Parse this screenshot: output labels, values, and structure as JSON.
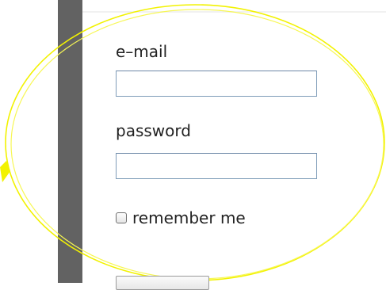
{
  "login_form": {
    "email_label": "e–mail",
    "email_value": "",
    "password_label": "password",
    "password_value": "",
    "remember_label": "remember me",
    "remember_checked": false
  },
  "colors": {
    "sidebar": "#626262",
    "highlight": "#f2f200",
    "input_border": "#7f9db9"
  }
}
